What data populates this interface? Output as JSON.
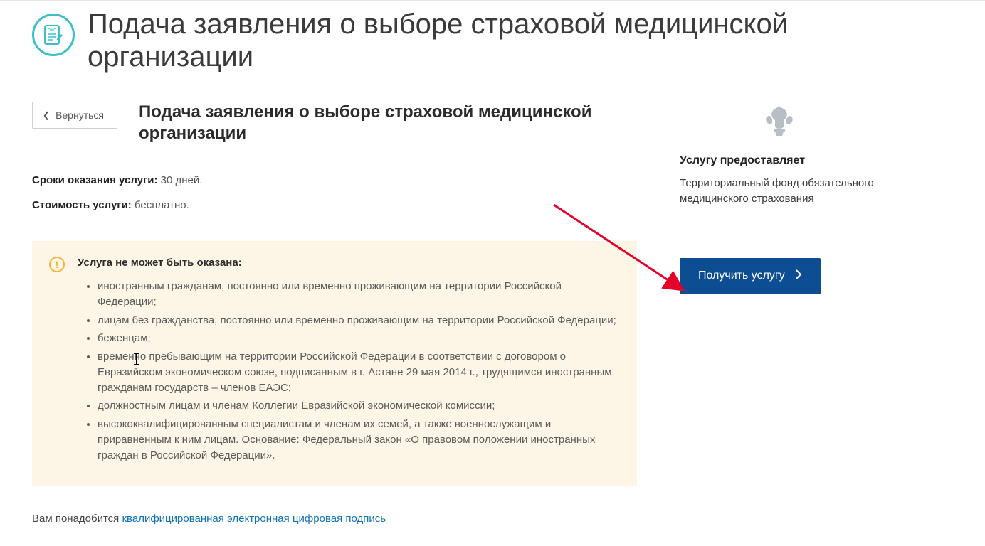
{
  "header": {
    "title": "Подача заявления о выборе страховой медицинской организации"
  },
  "back_button": {
    "label": "Вернуться"
  },
  "subtitle": "Подача заявления о выборе страховой медицинской организации",
  "meta": {
    "duration_label": "Сроки оказания услуги:",
    "duration_value": "30 дней.",
    "cost_label": "Стоимость услуги:",
    "cost_value": "бесплатно."
  },
  "warning": {
    "title": "Услуга не может быть оказана:",
    "items": [
      "иностранным гражданам, постоянно или временно проживающим на территории Российской Федерации;",
      "лицам без гражданства, постоянно или временно проживающим на территории Российской Федерации;",
      "беженцам;",
      "временно пребывающим на территории Российской Федерации в соответствии с договором о Евразийском экономическом союзе, подписанным в г. Астане 29 мая 2014 г., трудящимся иностранным гражданам государств – членов ЕАЭС;",
      "должностным лицам и членам Коллегии Евразийской экономической комиссии;",
      "высококвалифицированным специалистам и членам их семей, а также военнослужащим и приравненным к ним лицам. Основание: Федеральный закон «О правовом положении иностранных граждан в Российской Федерации»."
    ]
  },
  "note": {
    "prefix": "Вам понадобится ",
    "link_text": "квалифицированная электронная цифровая подпись"
  },
  "aside": {
    "provider_heading": "Услугу предоставляет",
    "provider_name": "Территориальный фонд обязательного медицинского страхования",
    "cta_label": "Получить услугу"
  }
}
